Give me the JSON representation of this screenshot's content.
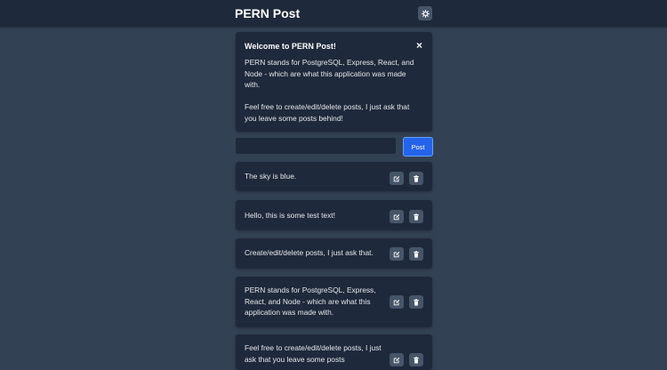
{
  "header": {
    "brand": "PERN Post",
    "theme_icon": "gear-icon"
  },
  "welcome": {
    "title": "Welcome to PERN Post!",
    "close_label": "×",
    "paragraph1": "PERN stands for PostgreSQL, Express, React, and Node - which are what this application was made with.",
    "paragraph2": "Feel free to create/edit/delete posts, I just ask that you leave some posts behind!"
  },
  "composer": {
    "input_value": "",
    "input_placeholder": "",
    "post_label": "Post"
  },
  "posts": [
    {
      "text": "The sky is blue."
    },
    {
      "text": "Hello, this is some test text!"
    },
    {
      "text": "Create/edit/delete posts, I just ask that."
    },
    {
      "text": "PERN stands for PostgreSQL, Express, React, and Node - which are what this application was made with."
    },
    {
      "text": "Feel free to create/edit/delete posts, I just ask that you leave some posts"
    }
  ],
  "icons": {
    "edit": "edit-icon",
    "delete": "trash-icon"
  },
  "colors": {
    "background": "#334155",
    "navbar": "#1e293b",
    "card": "#1e293b",
    "accent": "#2563eb",
    "icon_button": "#475569"
  }
}
